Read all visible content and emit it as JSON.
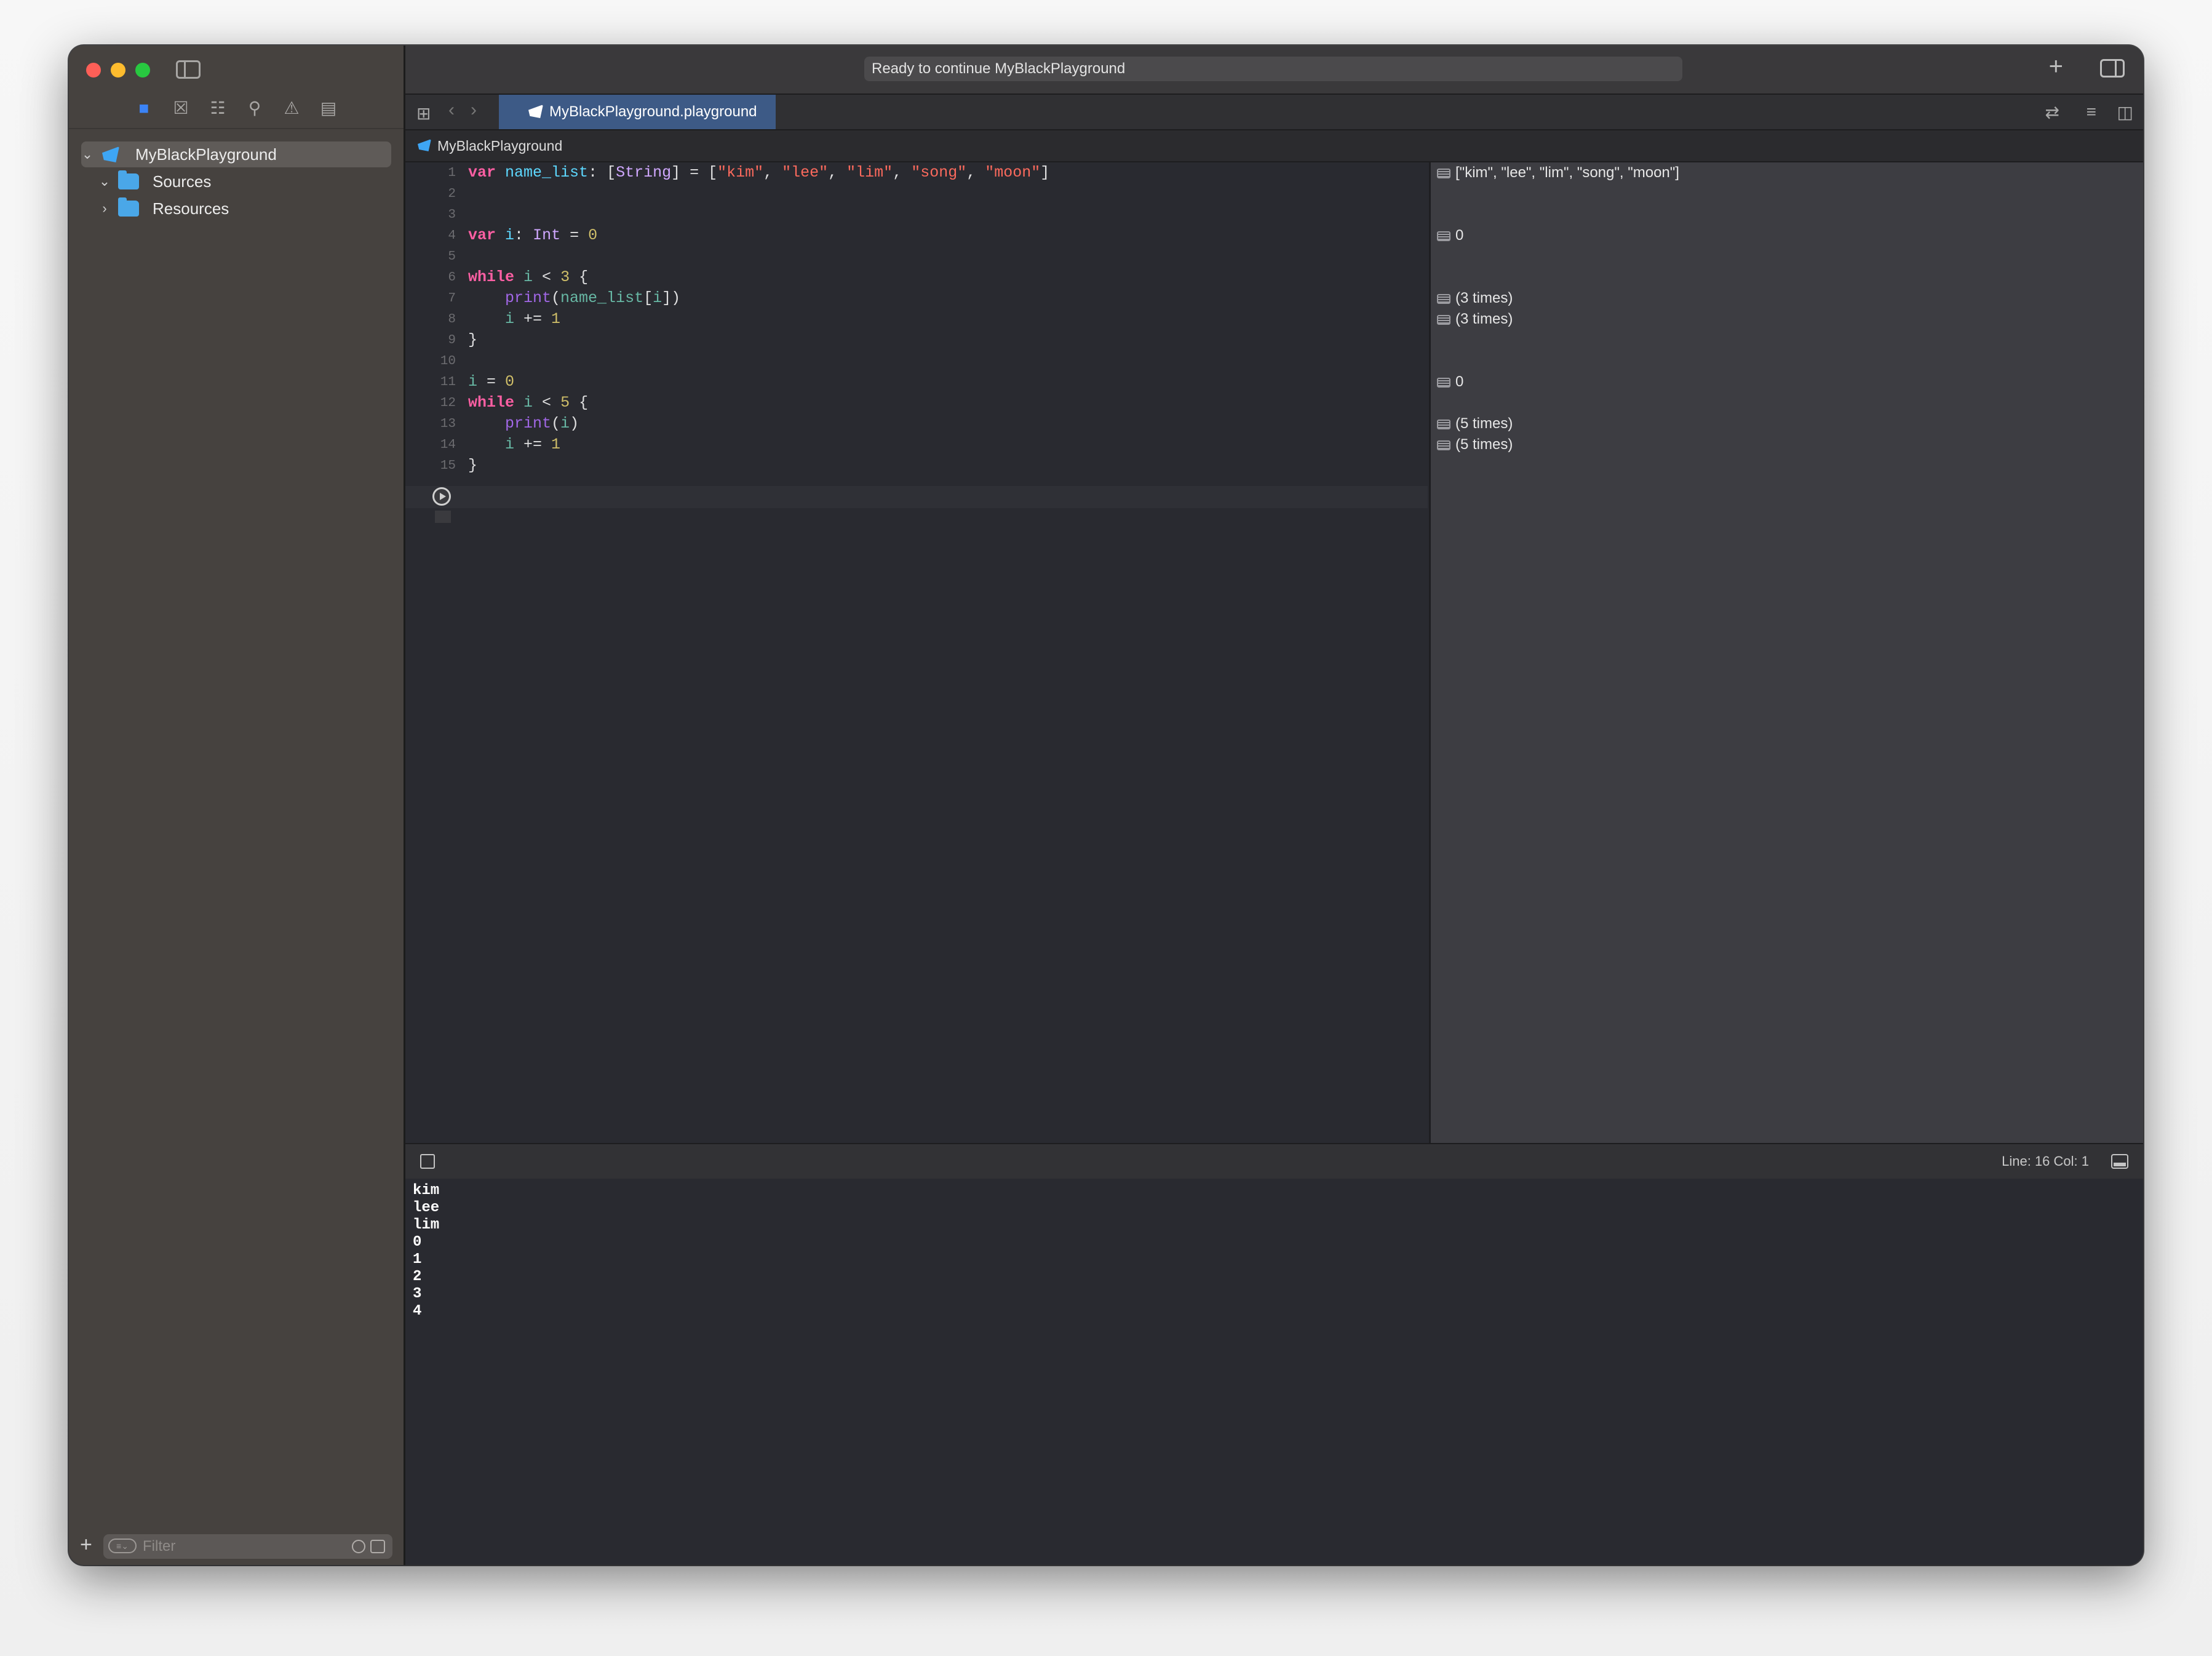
{
  "window": {
    "status": "Ready to continue MyBlackPlayground",
    "tab_title": "MyBlackPlayground.playground",
    "breadcrumb": "MyBlackPlayground"
  },
  "sidebar": {
    "nav_icons": [
      "folder-icon",
      "source-control-icon",
      "hierarchy-icon",
      "search-icon",
      "warning-icon",
      "report-icon"
    ],
    "tree": [
      {
        "label": "MyBlackPlayground",
        "expanded": true,
        "selected": true,
        "kind": "playground"
      },
      {
        "label": "Sources",
        "expanded": true,
        "kind": "folder"
      },
      {
        "label": "Resources",
        "expanded": false,
        "kind": "folder"
      }
    ],
    "filter_placeholder": "Filter"
  },
  "editor": {
    "line_numbers": [
      "1",
      "2",
      "3",
      "4",
      "5",
      "6",
      "7",
      "8",
      "9",
      "10",
      "11",
      "12",
      "13",
      "14",
      "15"
    ],
    "code": [
      "var name_list: [String] = [\"kim\", \"lee\", \"lim\", \"song\", \"moon\"]",
      "",
      "",
      "var i: Int = 0",
      "",
      "while i < 3 {",
      "    print(name_list[i])",
      "    i += 1",
      "}",
      "",
      "i = 0",
      "while i < 5 {",
      "    print(i)",
      "    i += 1",
      "}"
    ]
  },
  "results": [
    {
      "line": 1,
      "text": "[\"kim\", \"lee\", \"lim\", \"song\", \"moon\"]"
    },
    {
      "line": 4,
      "text": "0"
    },
    {
      "line": 7,
      "text": "(3 times)"
    },
    {
      "line": 8,
      "text": "(3 times)"
    },
    {
      "line": 11,
      "text": "0"
    },
    {
      "line": 13,
      "text": "(5 times)"
    },
    {
      "line": 14,
      "text": "(5 times)"
    }
  ],
  "debug": {
    "line_col": "Line: 16  Col: 1"
  },
  "console": [
    "kim",
    "lee",
    "lim",
    "0",
    "1",
    "2",
    "3",
    "4"
  ]
}
